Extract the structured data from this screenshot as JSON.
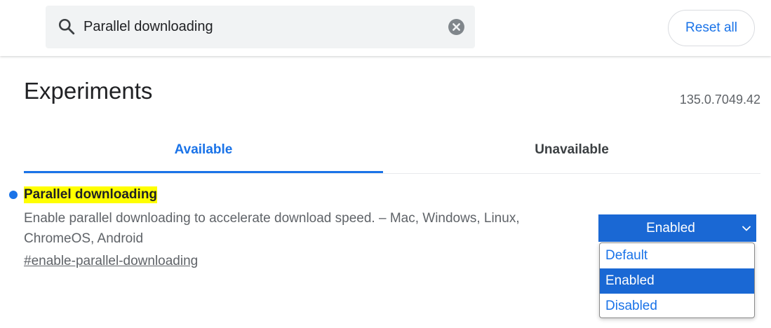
{
  "search": {
    "value": "Parallel downloading",
    "icon": "search-icon",
    "clear_icon": "close-circle-icon"
  },
  "header": {
    "reset_label": "Reset all"
  },
  "page": {
    "title": "Experiments",
    "version": "135.0.7049.42"
  },
  "tabs": [
    {
      "label": "Available",
      "active": true
    },
    {
      "label": "Unavailable",
      "active": false
    }
  ],
  "experiment": {
    "name": "Parallel downloading",
    "description": "Enable parallel downloading to accelerate download speed. – Mac, Windows, Linux, ChromeOS, Android",
    "link": "#enable-parallel-downloading",
    "selected_value": "Enabled",
    "options": [
      "Default",
      "Enabled",
      "Disabled"
    ]
  },
  "colors": {
    "accent": "#1a73e8",
    "select_bg": "#1a68d4",
    "highlight": "#ffff00",
    "search_bg": "#f1f3f4"
  }
}
